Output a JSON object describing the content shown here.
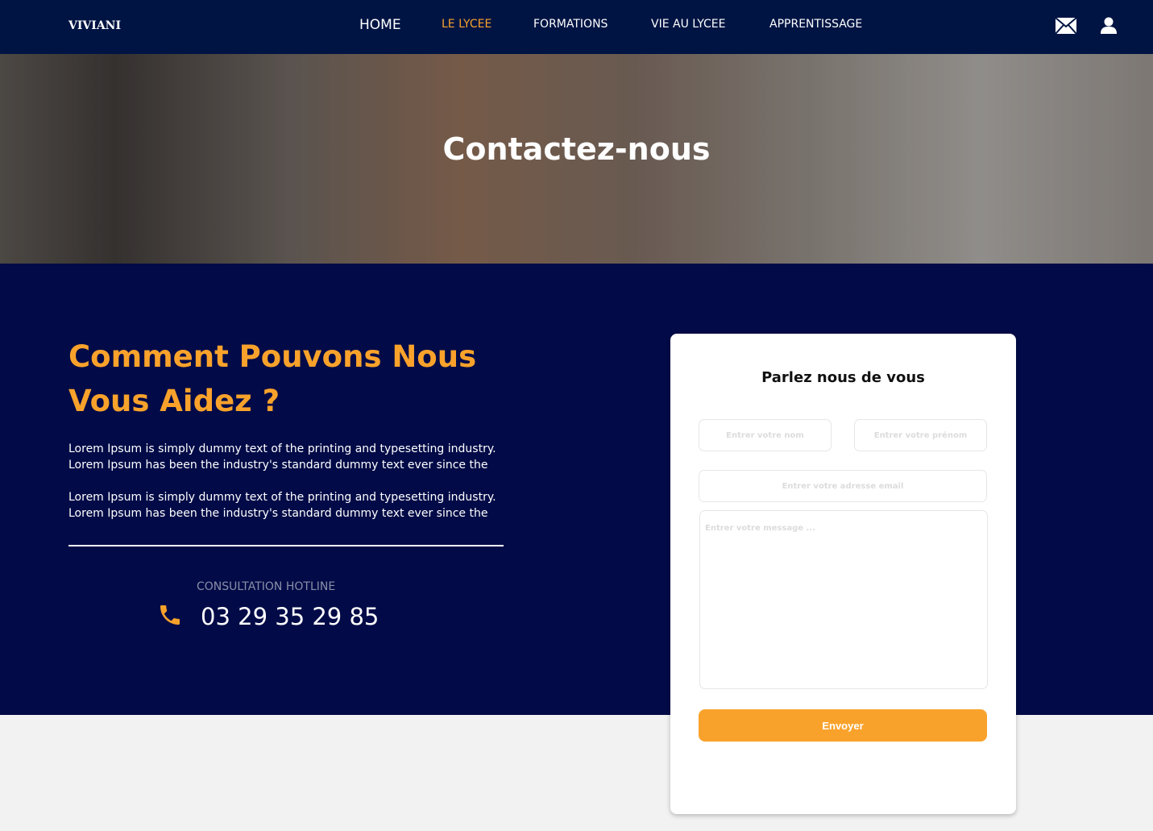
{
  "nav": {
    "logo": "VIVIANI",
    "items": [
      "HOME",
      "LE LYCEE",
      "FORMATIONS",
      "VIE AU LYCEE",
      "APPRENTISSAGE"
    ],
    "active": "LE LYCEE"
  },
  "hero": {
    "title": "Contactez-nous"
  },
  "main": {
    "heading": "Comment Pouvons Nous Vous Aidez ?",
    "paragraphs": [
      "Lorem Ipsum is simply dummy text of the printing and typesetting industry. Lorem Ipsum has been the industry's standard dummy text ever since the",
      "Lorem Ipsum is simply dummy text of the printing and typesetting industry. Lorem Ipsum has been the industry's standard dummy text ever since the"
    ],
    "hotline_label": "CONSULTATION HOTLINE",
    "hotline_number": "03 29 35 29 85"
  },
  "form": {
    "title": "Parlez nous de vous",
    "name_placeholder": "Entrer votre nom",
    "firstname_placeholder": "Entrer votre prénom",
    "email_placeholder": "Entrer votre adresse email",
    "message_placeholder": "Entrer votre message ...",
    "submit": "Envoyer"
  },
  "colors": {
    "navy": "#001443",
    "accent": "#f9a22b"
  }
}
